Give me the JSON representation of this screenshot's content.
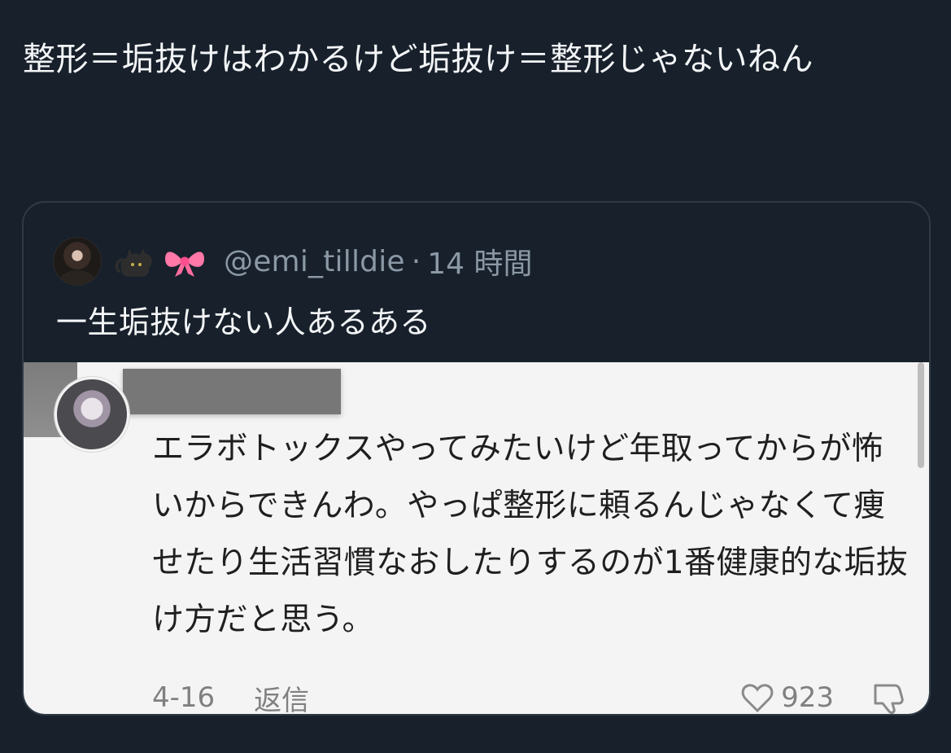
{
  "tweet": {
    "text": "整形＝垢抜けはわかるけど垢抜け＝整形じゃないねん"
  },
  "quote": {
    "handle": "@emi_tilldie",
    "separator": "·",
    "time": "14 時間",
    "text": "一生垢抜けない人あるある"
  },
  "comment": {
    "text": "エラボトックスやってみたいけど年取ってからが怖いからできんわ。やっぱ整形に頼るんじゃなくて痩せたり生活習慣なおしたりするのが1番健康的な垢抜け方だと思う。",
    "date": "4-16",
    "reply_label": "返信",
    "likes": "923"
  },
  "icons": {
    "cat": "cat-icon",
    "bow": "ribbon-icon",
    "heart": "heart-outline-icon",
    "dislike": "thumbs-down-outline-icon"
  },
  "colors": {
    "background": "#17202b",
    "muted_text": "#8b98a5",
    "card_border": "#2f3a45",
    "screenshot_bg": "#f4f4f4"
  }
}
